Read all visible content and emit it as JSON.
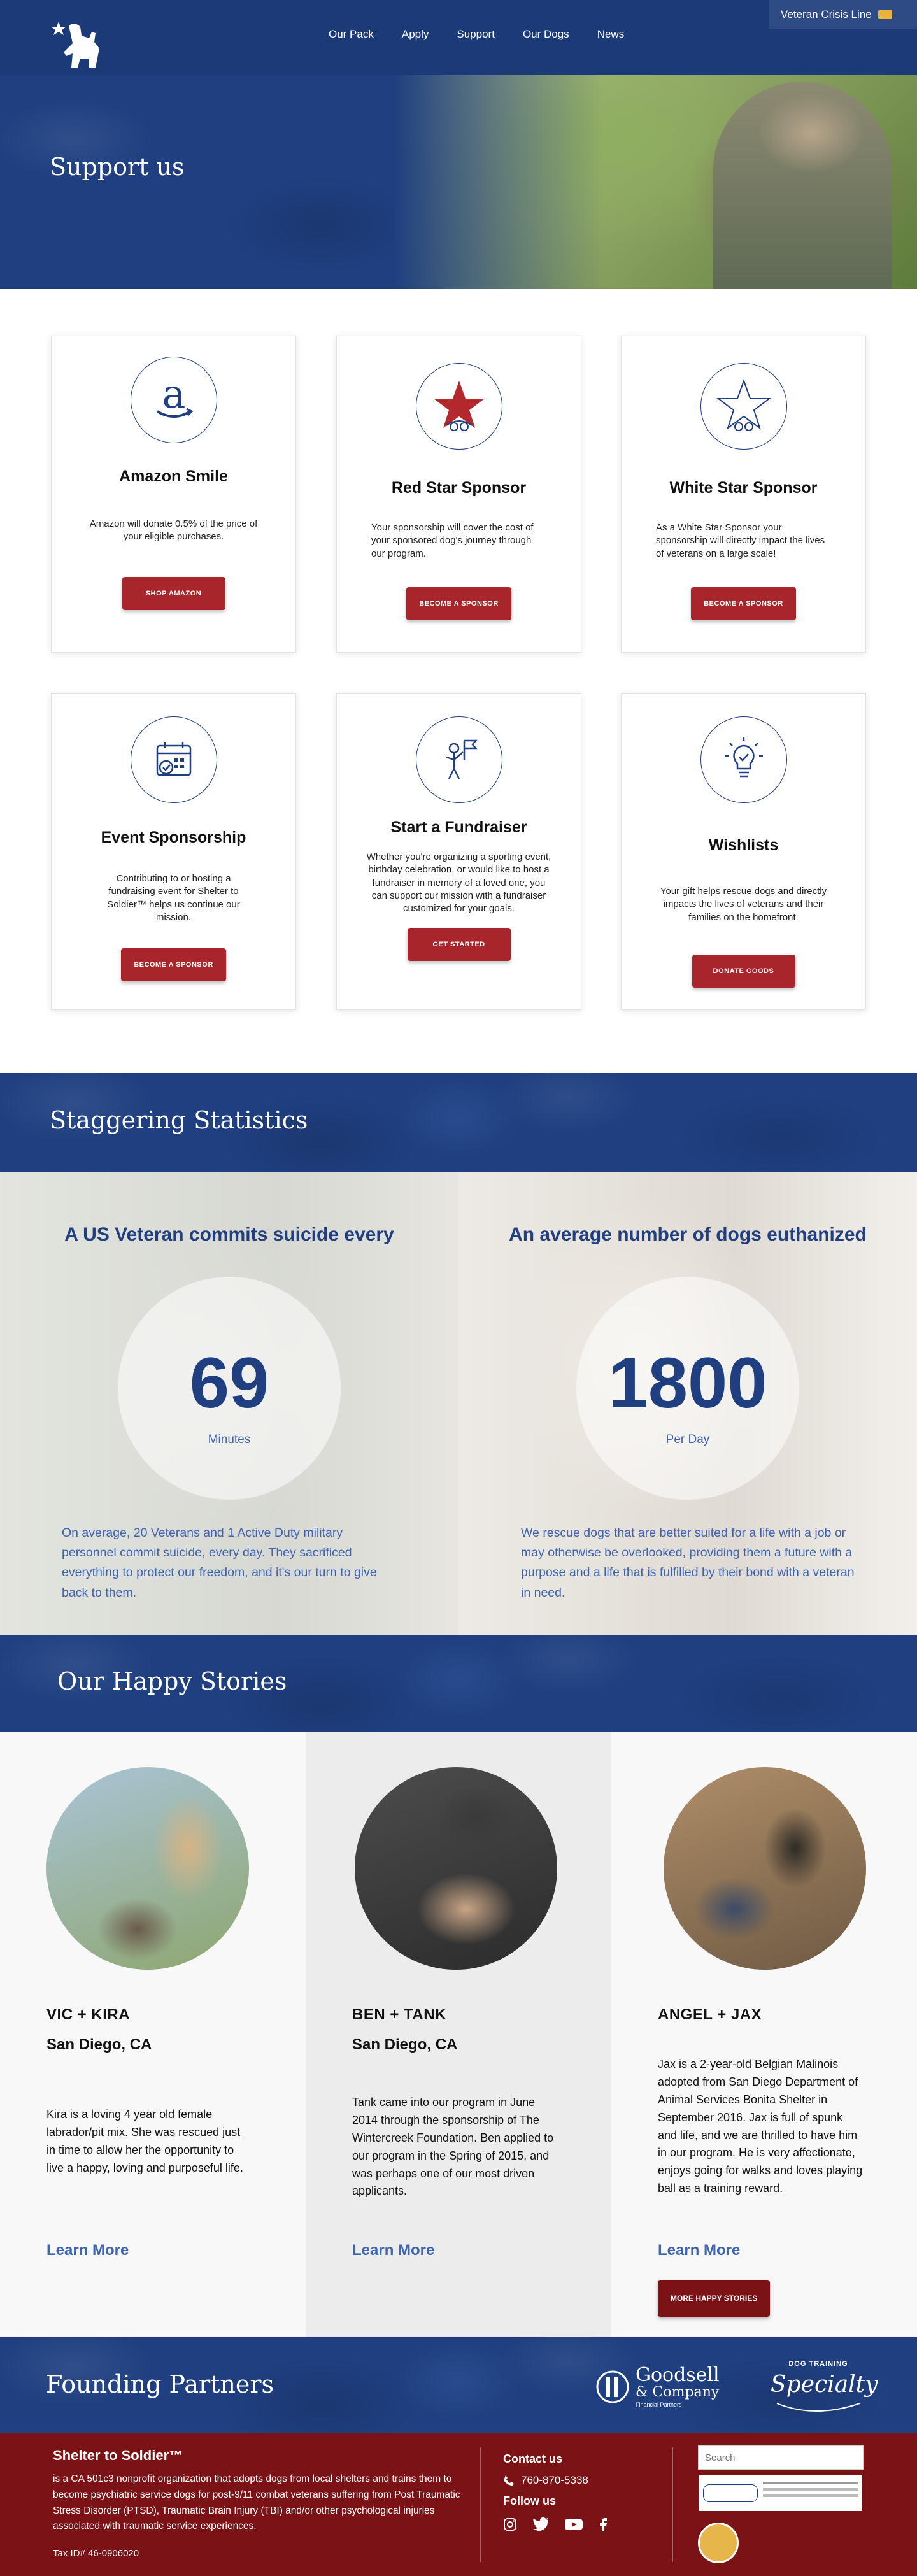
{
  "header": {
    "nav": [
      "Our Pack",
      "Apply",
      "Support",
      "Our Dogs",
      "News"
    ],
    "crisis_line": "Veteran Crisis Line"
  },
  "hero": {
    "title": "Support us"
  },
  "cards": [
    {
      "title": "Amazon Smile",
      "text": "Amazon will donate 0.5% of the price of your eligible purchases.",
      "button": "SHOP AMAZON",
      "icon": "amazon-icon"
    },
    {
      "title": "Red Star Sponsor",
      "text": "Your sponsorship will cover the cost of your sponsored dog's journey through our program.",
      "button": "BECOME A SPONSOR",
      "icon": "red-star-icon"
    },
    {
      "title": "White Star Sponsor",
      "text": "As a White Star Sponsor your sponsorship will directly impact the lives of veterans on a large scale!",
      "button": "BECOME A SPONSOR",
      "icon": "white-star-icon"
    },
    {
      "title": "Event Sponsorship",
      "text": "Contributing to or hosting a fundraising event for Shelter to Soldier™ helps us continue our mission.",
      "button": "BECOME A SPONSOR",
      "icon": "calendar-icon"
    },
    {
      "title": "Start a Fundraiser",
      "text": "Whether you're organizing a sporting event, birthday celebration, or would like to host a fundraiser in memory of a loved one, you can support our mission with a fundraiser customized for your goals.",
      "button": "GET STARTED",
      "icon": "person-flag-icon"
    },
    {
      "title": "Wishlists",
      "text": "Your gift helps rescue dogs and directly impacts the lives of veterans and their families on the homefront.",
      "button": "DONATE GOODS",
      "icon": "lightbulb-icon"
    }
  ],
  "stats": {
    "title": "Staggering Statistics",
    "items": [
      {
        "heading": "A US Veteran commits suicide every",
        "number": "69",
        "unit": "Minutes",
        "text": "On average, 20 Veterans and 1 Active Duty military personnel commit suicide, every day. They sacrificed everything to protect our freedom, and it's our turn to give back to them."
      },
      {
        "heading": "An average number of dogs euthanized",
        "number": "1800",
        "unit": "Per Day",
        "text": "We rescue dogs that are better suited for a life with a job or may otherwise be overlooked, providing them a future with a purpose and a life that is fulfilled by their bond with a veteran in need."
      }
    ]
  },
  "stories": {
    "title": "Our Happy Stories",
    "items": [
      {
        "name": "VIC + KIRA",
        "city": "San Diego, CA",
        "text": "Kira is a loving 4 year old female labrador/pit mix. She was rescued just in time to allow her the opportunity to live a happy, loving and purposeful life.",
        "link": "Learn More"
      },
      {
        "name": "BEN + TANK",
        "city": "San Diego, CA",
        "text": "Tank came into our program in June 2014 through the sponsorship of The Wintercreek Foundation. Ben applied to our program in the Spring of 2015, and was perhaps one of our most driven applicants.",
        "link": "Learn More"
      },
      {
        "name": "ANGEL + JAX",
        "city": "",
        "text": "Jax is a 2-year-old Belgian Malinois adopted from San Diego Department of Animal Services Bonita Shelter in September 2016. Jax is full of spunk and life, and we are thrilled to have him in our program. He is very affectionate, enjoys going for walks and loves playing ball as a training reward.",
        "link": "Learn More"
      }
    ],
    "more_button": "MORE HAPPY STORIES"
  },
  "partners": {
    "title": "Founding Partners",
    "goodsell": {
      "name": "Goodsell",
      "sub": "& Company",
      "tag": "Financial Partners"
    },
    "specialty": {
      "top": "DOG TRAINING",
      "name": "Specialty"
    }
  },
  "footer": {
    "org_name": "Shelter to Soldier™",
    "about": " is a CA 501c3 nonprofit organization that adopts dogs from local shelters and trains them to become psychiatric service dogs for post-9/11 combat veterans suffering from Post Traumatic Stress Disorder (PTSD), Traumatic Brain Injury (TBI) and/or other psychological injuries associated with traumatic service experiences.",
    "tax_id": "Tax ID# 46-0906020",
    "contact_title": "Contact us",
    "phone": "760-870-5338",
    "follow_title": "Follow us",
    "search_placeholder": "Search"
  }
}
